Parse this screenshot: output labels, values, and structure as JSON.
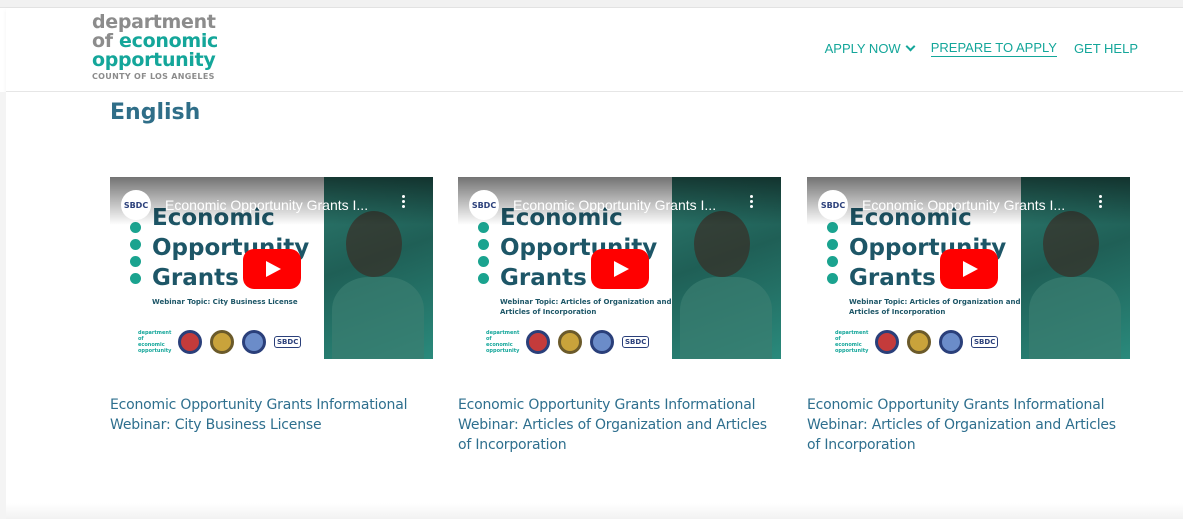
{
  "header": {
    "logo": {
      "line1": "department",
      "line2_prefix": "of ",
      "line2_highlight": "economic",
      "line3": "opportunity",
      "line4": "COUNTY OF LOS ANGELES"
    },
    "nav": [
      {
        "label": "APPLY NOW"
      },
      {
        "label": "PREPARE TO APPLY"
      },
      {
        "label": "GET HELP"
      }
    ]
  },
  "main": {
    "section_title": "English",
    "videos": [
      {
        "yt_title": "Economic Opportunity Grants I...",
        "channel": "SBDC",
        "thumb_line1": "Economic",
        "thumb_line2": "Opportunity",
        "thumb_line3": "Grants",
        "topic": "Webinar Topic: City Business License",
        "caption": "Economic Opportunity Grants Informational Webinar: City Business License"
      },
      {
        "yt_title": "Economic Opportunity Grants I...",
        "channel": "SBDC",
        "thumb_line1": "Economic",
        "thumb_line2": "Opportunity",
        "thumb_line3": "Grants",
        "topic": "Webinar Topic: Articles of Organization and Articles of Incorporation",
        "caption": "Economic Opportunity Grants Informational Webinar: Articles of Organization and Articles of Incorporation"
      },
      {
        "yt_title": "Economic Opportunity Grants I...",
        "channel": "SBDC",
        "thumb_line1": "Economic",
        "thumb_line2": "Opportunity",
        "thumb_line3": "Grants",
        "topic": "Webinar Topic: Articles of Organization and Articles of Incorporation",
        "caption": "Economic Opportunity Grants Informational Webinar: Articles of Organization and Articles of Incorporation"
      }
    ]
  },
  "colors": {
    "brand_teal": "#14a69a",
    "brand_gray": "#8c8c8c",
    "heading_blue": "#2f6e88",
    "caption_blue": "#2e6f8e",
    "youtube_red": "#ff0000"
  }
}
